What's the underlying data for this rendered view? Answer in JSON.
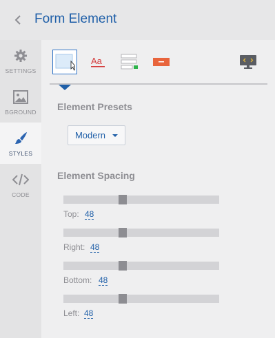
{
  "header": {
    "title": "Form Element",
    "back_icon": "chevron-left-icon"
  },
  "sidebar": {
    "items": [
      {
        "label": "SETTINGS",
        "icon": "gear-icon"
      },
      {
        "label": "BGROUND",
        "icon": "image-icon"
      },
      {
        "label": "STYLES",
        "icon": "brush-icon",
        "active": true
      },
      {
        "label": "CODE",
        "icon": "code-icon"
      }
    ]
  },
  "toolbar": {
    "tools": [
      {
        "name": "box-layout",
        "icon": "box-select-icon",
        "active": true
      },
      {
        "name": "typography",
        "icon": "text-style-icon"
      },
      {
        "name": "form-fields",
        "icon": "form-fields-icon"
      },
      {
        "name": "button-style",
        "icon": "button-icon"
      },
      {
        "name": "preview",
        "icon": "monitor-code-icon"
      }
    ]
  },
  "presets": {
    "title": "Element Presets",
    "selected": "Modern"
  },
  "spacing": {
    "title": "Element Spacing",
    "sliders": [
      {
        "label": "Top:",
        "value": "48"
      },
      {
        "label": "Right:",
        "value": "48"
      },
      {
        "label": "Bottom:",
        "value": "48"
      },
      {
        "label": "Left:",
        "value": "48"
      }
    ]
  },
  "colors": {
    "accent": "#1f5fa8",
    "red": "#d43b3b",
    "orange": "#e8643c",
    "green": "#2db34a"
  }
}
